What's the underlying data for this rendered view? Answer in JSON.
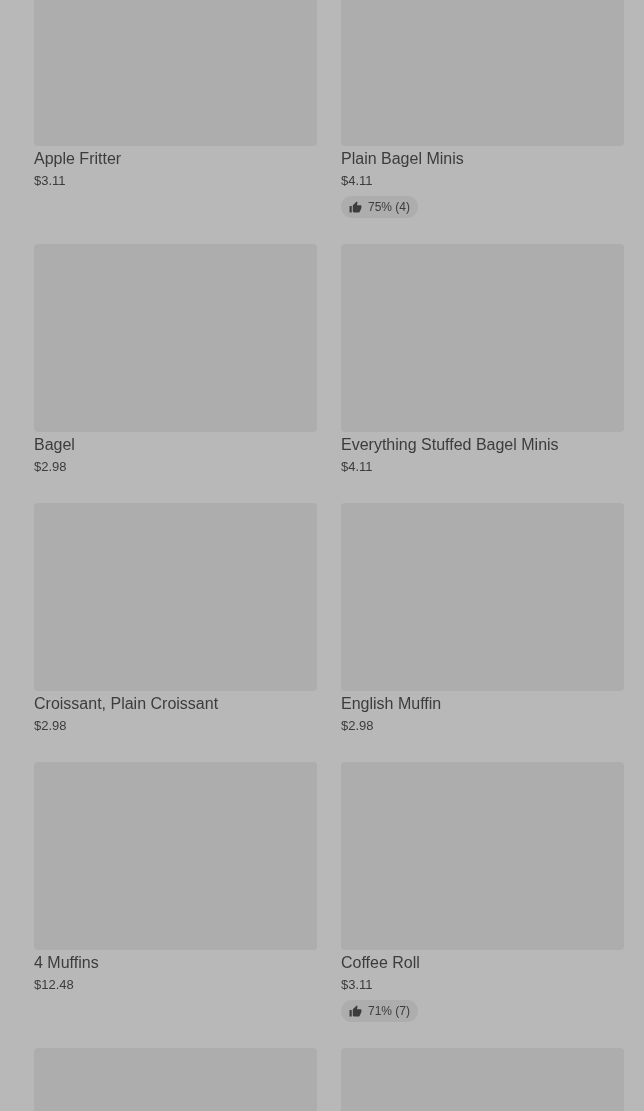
{
  "products": [
    {
      "kind": "product",
      "name": "Apple Fritter",
      "price": "$3.11"
    },
    {
      "kind": "product",
      "name": "Plain Bagel Minis",
      "price": "$4.11",
      "rating": "75% (4)"
    },
    {
      "kind": "product",
      "name": "Bagel",
      "price": "$2.98"
    },
    {
      "kind": "product",
      "name": "Everything Stuffed Bagel Minis",
      "price": "$4.11"
    },
    {
      "kind": "product",
      "name": "Croissant, Plain Croissant",
      "price": "$2.98"
    },
    {
      "kind": "product",
      "name": "English Muffin",
      "price": "$2.98"
    },
    {
      "kind": "product",
      "name": "4 Muffins",
      "price": "$12.48"
    },
    {
      "kind": "product",
      "name": "Coffee Roll",
      "price": "$3.11",
      "rating": "71% (7)"
    },
    {
      "kind": "image_only"
    },
    {
      "kind": "image_only"
    }
  ]
}
